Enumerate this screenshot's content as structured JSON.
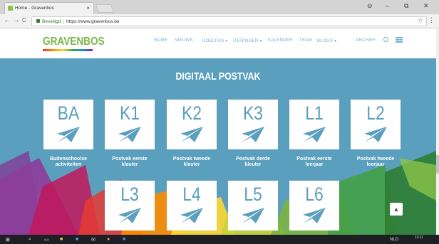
{
  "browser": {
    "tab_title": "Home - Gravenbos",
    "tab_close": "×",
    "window_controls": {
      "user": "⊖",
      "minimize": "–",
      "maximize": "⧉",
      "close": "✕"
    },
    "nav": {
      "back": "←",
      "forward": "→",
      "reload": "C"
    },
    "address": {
      "secure_label": "Beveiligd",
      "url": "https://www.gravenbos.be"
    },
    "star": "☆",
    "menu": "⋮"
  },
  "site": {
    "logo": "GRAVENBOS",
    "nav_items": [
      "HOME",
      "NIEUWS",
      "DOELFUS ▾",
      "ITERINGEN ▾",
      "KALENDER",
      "TEAM",
      "BLOGS ▾",
      "ARCHIEF"
    ]
  },
  "main": {
    "title": "DIGITAAL POSTVAK",
    "tiles": [
      {
        "code": "BA",
        "label_line1": "Buitenschoolse",
        "label_line2": "activiteiten"
      },
      {
        "code": "K1",
        "label_line1": "Postvak eerste",
        "label_line2": "kleuter"
      },
      {
        "code": "K2",
        "label_line1": "Postvak tweede",
        "label_line2": "kleuter"
      },
      {
        "code": "K3",
        "label_line1": "Postvak derde",
        "label_line2": "kleuter"
      },
      {
        "code": "L1",
        "label_line1": "Postvak eerste",
        "label_line2": "leerjaar"
      },
      {
        "code": "L2",
        "label_line1": "Postvak tweede",
        "label_line2": "leerjaar"
      },
      {
        "code": "L3",
        "label_line1": "",
        "label_line2": ""
      },
      {
        "code": "L4",
        "label_line1": "",
        "label_line2": ""
      },
      {
        "code": "L5",
        "label_line1": "",
        "label_line2": ""
      },
      {
        "code": "L6",
        "label_line1": "",
        "label_line2": ""
      }
    ],
    "scroll_top_glyph": "▲"
  },
  "taskbar": {
    "time": "13:11",
    "language": "NLD"
  },
  "colors": {
    "accent": "#5a9fbd",
    "logo_green": "#7ab648",
    "nav_blue": "#7ab0cc"
  }
}
